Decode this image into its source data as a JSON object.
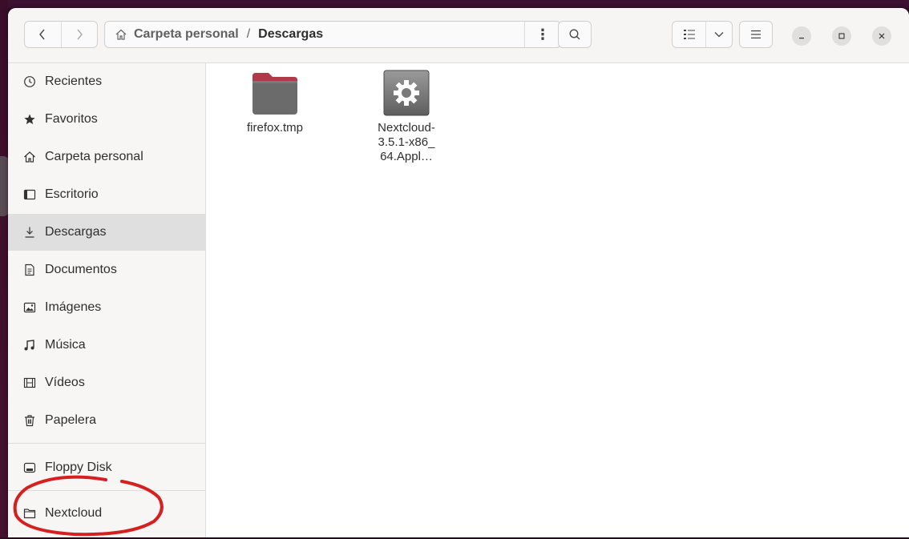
{
  "window": {
    "title": "Descargas"
  },
  "header": {
    "back_icon": "chevron-left-icon",
    "forward_icon": "chevron-right-icon",
    "path": {
      "home_icon": "home-icon",
      "parent": "Carpeta personal",
      "separator": "/",
      "current": "Descargas",
      "menu_glyph": "⋮"
    },
    "search_icon": "search-icon",
    "view_icon": "list-view-icon",
    "view_dropdown_icon": "chevron-down-icon",
    "main_menu_icon": "hamburger-menu-icon",
    "window_controls": [
      "minimize",
      "maximize",
      "close"
    ]
  },
  "sidebar": {
    "items": [
      {
        "label": "Recientes",
        "icon": "clock-icon"
      },
      {
        "label": "Favoritos",
        "icon": "star-icon"
      },
      {
        "label": "Carpeta personal",
        "icon": "home-icon"
      },
      {
        "label": "Escritorio",
        "icon": "desktop-icon"
      },
      {
        "label": "Descargas",
        "icon": "download-icon",
        "active": true
      },
      {
        "label": "Documentos",
        "icon": "document-icon"
      },
      {
        "label": "Imágenes",
        "icon": "image-icon"
      },
      {
        "label": "Música",
        "icon": "music-icon"
      },
      {
        "label": "Vídeos",
        "icon": "video-icon"
      },
      {
        "label": "Papelera",
        "icon": "trash-icon"
      }
    ],
    "devices": [
      {
        "label": "Floppy Disk",
        "icon": "drive-icon"
      }
    ],
    "bookmarks": [
      {
        "label": "Nextcloud",
        "icon": "folder-icon"
      }
    ]
  },
  "files": [
    {
      "name": "firefox.tmp",
      "icon": "folder-icon"
    },
    {
      "name": "Nextcloud-3.5.1-x86_64.Appl…",
      "display_lines": [
        "Nextcloud-",
        "3.5.1-x86_",
        "64.Appl…"
      ],
      "icon": "executable-gear-icon"
    }
  ],
  "colors": {
    "folder_top": "#b23a48",
    "folder_body": "#6b6b6b",
    "annotation": "#d62020",
    "sidebar_active": "#e0dfdf"
  }
}
